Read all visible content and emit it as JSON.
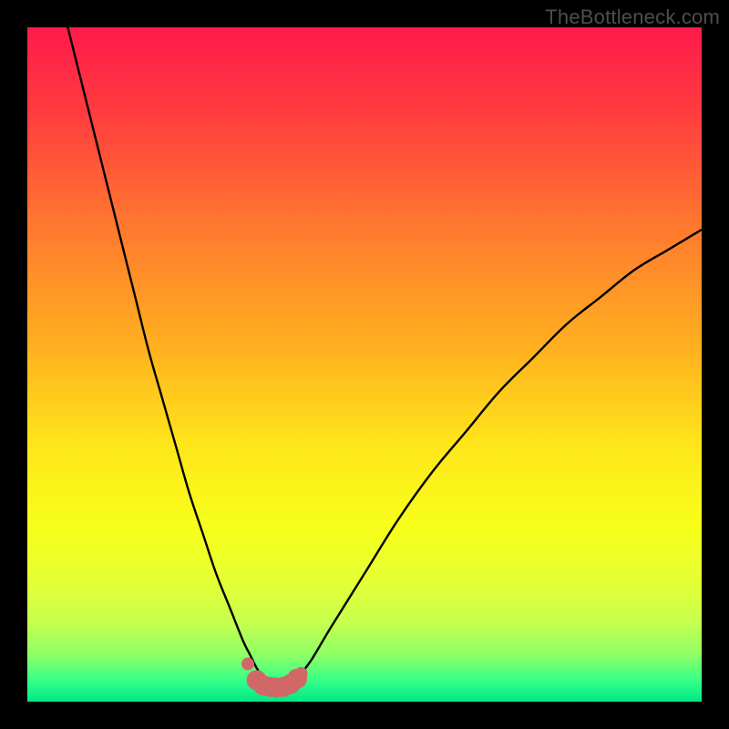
{
  "watermark": "TheBottleneck.com",
  "chart_data": {
    "type": "line",
    "title": "",
    "xlabel": "",
    "ylabel": "",
    "xlim": [
      0,
      100
    ],
    "ylim": [
      0,
      100
    ],
    "grid": false,
    "series": [
      {
        "name": "bottleneck-curve",
        "x": [
          6,
          8,
          10,
          12,
          14,
          16,
          18,
          20,
          22,
          24,
          26,
          28,
          30,
          32,
          33,
          34,
          35,
          36,
          37,
          38,
          39,
          40,
          42,
          45,
          50,
          55,
          60,
          65,
          70,
          75,
          80,
          85,
          90,
          95,
          100
        ],
        "y": [
          100,
          92,
          84,
          76,
          68,
          60,
          52,
          45,
          38,
          31,
          25,
          19,
          14,
          9,
          7,
          5,
          3.5,
          2.5,
          2,
          2,
          2.5,
          3.5,
          6,
          11,
          19,
          27,
          34,
          40,
          46,
          51,
          56,
          60,
          64,
          67,
          70
        ]
      }
    ],
    "highlight_band": {
      "name": "optimal-range-dots",
      "x": [
        32.7,
        34,
        35,
        36,
        37,
        38,
        39,
        40,
        40.6
      ],
      "y": [
        5.6,
        3.2,
        2.4,
        2.2,
        2.1,
        2.2,
        2.6,
        3.4,
        4.2
      ]
    },
    "background_gradient_stops": [
      {
        "offset": 0.0,
        "color": "#ff1a4b"
      },
      {
        "offset": 0.12,
        "color": "#ff3a3f"
      },
      {
        "offset": 0.3,
        "color": "#ff7a2e"
      },
      {
        "offset": 0.48,
        "color": "#ffb21f"
      },
      {
        "offset": 0.62,
        "color": "#ffe61a"
      },
      {
        "offset": 0.74,
        "color": "#f7ff1a"
      },
      {
        "offset": 0.82,
        "color": "#e6ff33"
      },
      {
        "offset": 0.88,
        "color": "#c8ff4d"
      },
      {
        "offset": 0.93,
        "color": "#8fff66"
      },
      {
        "offset": 0.97,
        "color": "#33ff88"
      },
      {
        "offset": 1.0,
        "color": "#00e884"
      }
    ]
  }
}
